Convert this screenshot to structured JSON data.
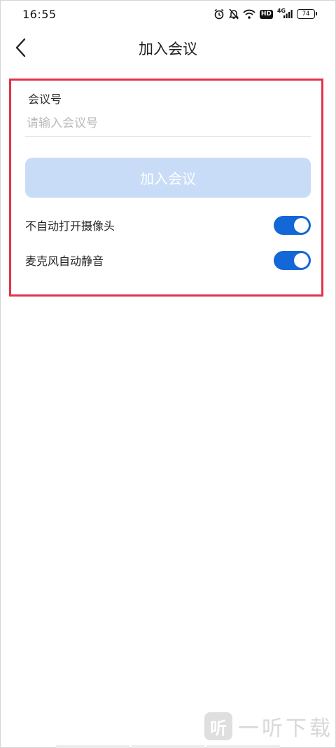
{
  "status_bar": {
    "time": "16:55",
    "icons": [
      "alarm-icon",
      "mute-bell-icon",
      "wifi-icon",
      "hd-icon",
      "4g-signal-icon",
      "battery-icon"
    ],
    "hd_label": "HD",
    "network_label": "4G",
    "battery_level": "74"
  },
  "header": {
    "title": "加入会议",
    "back_icon": "chevron-left-icon"
  },
  "form": {
    "meeting_id_label": "会议号",
    "meeting_id_placeholder": "请输入会议号",
    "meeting_id_value": "",
    "join_button_label": "加入会议"
  },
  "options": [
    {
      "label": "不自动打开摄像头",
      "enabled": true
    },
    {
      "label": "麦克风自动静音",
      "enabled": true
    }
  ],
  "colors": {
    "accent": "#1467d6",
    "join_button_disabled": "#c9dcf7",
    "highlight_border": "#e2334a"
  },
  "watermark": {
    "logo_text": "听",
    "text": "一听下载"
  }
}
